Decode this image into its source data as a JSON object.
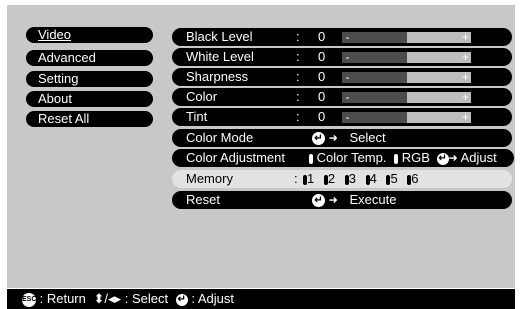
{
  "sidebar": {
    "items": [
      {
        "label": "Video",
        "active": true
      },
      {
        "label": "Advanced"
      },
      {
        "label": "Setting"
      },
      {
        "label": "About"
      },
      {
        "label": "Reset All"
      }
    ]
  },
  "settings": {
    "black_level": {
      "label": "Black Level",
      "value": "0",
      "level": 0.5
    },
    "white_level": {
      "label": "White Level",
      "value": "0",
      "level": 0.5
    },
    "sharpness": {
      "label": "Sharpness",
      "value": "0",
      "level": 0.5
    },
    "color": {
      "label": "Color",
      "value": "0",
      "level": 0.5
    },
    "tint": {
      "label": "Tint",
      "value": "0",
      "level": 0.5
    },
    "color_mode": {
      "label": "Color Mode",
      "action": "Select"
    },
    "color_adjustment": {
      "label": "Color Adjustment",
      "opt1": "Color Temp.",
      "opt2": "RGB",
      "action": "Adjust"
    },
    "memory": {
      "label": "Memory",
      "slots": [
        "1",
        "2",
        "3",
        "4",
        "5",
        "6"
      ]
    },
    "reset": {
      "label": "Reset",
      "action": "Execute"
    }
  },
  "symbols": {
    "colon": ":",
    "minus": "-",
    "plus": "+",
    "arrow": "➜",
    "enter_icon": "↵"
  },
  "footer": {
    "esc_icon": "ESC",
    "return_label": ": Return",
    "select_label": ": Select",
    "adjust_label": ": Adjust",
    "updown_glyph": "⬍",
    "slash": "/",
    "leftright_glyph": "◂▸"
  }
}
